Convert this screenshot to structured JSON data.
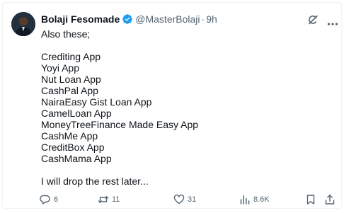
{
  "tweet": {
    "author_name": "Bolaji Fesomade",
    "handle": "@MasterBolaji",
    "separator": "·",
    "time": "9h",
    "lines": [
      "Also these;",
      "",
      "Crediting App",
      "Yoyi App",
      "Nut Loan App",
      "CashPal App",
      "NairaEasy Gist Loan App",
      "CamelLoan App",
      "MoneyTreeFinance Made Easy App",
      "CashMe App",
      "CreditBox App",
      "CashMama App",
      "",
      "I will drop the rest later..."
    ]
  },
  "actions": {
    "replies": "6",
    "reposts": "11",
    "likes": "31",
    "views": "8.6K"
  },
  "icons": {
    "verified": "verified-badge-icon",
    "grok": "grok-icon",
    "more": "more-icon",
    "reply": "reply-icon",
    "repost": "repost-icon",
    "like": "like-icon",
    "views": "views-icon",
    "bookmark": "bookmark-icon",
    "share": "share-icon"
  },
  "colors": {
    "verified": "#1d9bf0",
    "muted": "#536471",
    "text": "#0f1419"
  }
}
